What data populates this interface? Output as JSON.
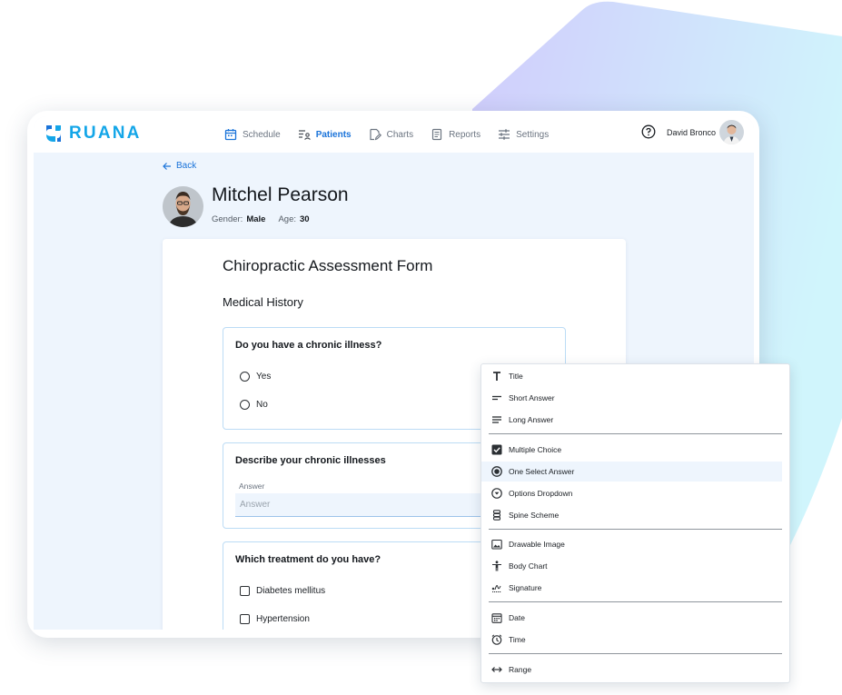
{
  "brand": {
    "name": "RUANA",
    "color": "#14a6e8"
  },
  "nav": {
    "items": [
      {
        "label": "Schedule",
        "icon": "calendar-icon",
        "active": false
      },
      {
        "label": "Patients",
        "icon": "patients-icon",
        "active": true
      },
      {
        "label": "Charts",
        "icon": "charts-icon",
        "active": false
      },
      {
        "label": "Reports",
        "icon": "reports-icon",
        "active": false
      },
      {
        "label": "Settings",
        "icon": "settings-icon",
        "active": false
      }
    ]
  },
  "user": {
    "name": "David Bronco",
    "help_icon": "help-icon"
  },
  "back_label": "Back",
  "patient": {
    "name": "Mitchel Pearson",
    "gender_label": "Gender:",
    "gender": "Male",
    "age_label": "Age:",
    "age": "30"
  },
  "form": {
    "title": "Chiropractic Assessment Form",
    "section": "Medical History",
    "questions": [
      {
        "title": "Do you have a chronic illness?",
        "type": "radio",
        "options": [
          "Yes",
          "No"
        ]
      },
      {
        "title": "Describe your chronic illnesses",
        "type": "text",
        "answer_label": "Answer",
        "placeholder": "Answer",
        "value": ""
      },
      {
        "title": "Which treatment do you have?",
        "type": "checkbox",
        "options": [
          "Diabetes mellitus",
          "Hypertension"
        ]
      }
    ]
  },
  "menu": {
    "groups": [
      [
        {
          "label": "Title",
          "icon": "title-icon"
        },
        {
          "label": "Short Answer",
          "icon": "short-answer-icon"
        },
        {
          "label": "Long Answer",
          "icon": "long-answer-icon"
        }
      ],
      [
        {
          "label": "Multiple Choice",
          "icon": "checkbox-icon"
        },
        {
          "label": "One Select Answer",
          "icon": "radio-icon",
          "selected": true
        },
        {
          "label": "Options Dropdown",
          "icon": "dropdown-icon"
        },
        {
          "label": "Spine Scheme",
          "icon": "spine-icon"
        }
      ],
      [
        {
          "label": "Drawable Image",
          "icon": "image-icon"
        },
        {
          "label": "Body Chart",
          "icon": "body-icon"
        },
        {
          "label": "Signature",
          "icon": "signature-icon"
        }
      ],
      [
        {
          "label": "Date",
          "icon": "date-icon"
        },
        {
          "label": "Time",
          "icon": "time-icon"
        }
      ],
      [
        {
          "label": "Range",
          "icon": "range-icon"
        }
      ]
    ]
  },
  "colors": {
    "accent": "#1a73d9",
    "page_bg": "#eef5fd",
    "border": "#bcdcf5"
  }
}
